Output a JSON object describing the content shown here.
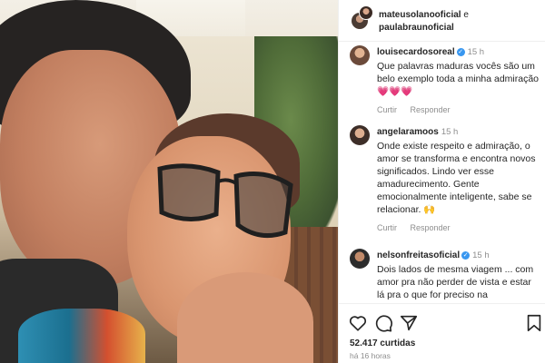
{
  "post": {
    "authors": [
      "mateusolanooficial",
      "paulabraunoficial"
    ],
    "conjunction": "e"
  },
  "comments": [
    {
      "user": "louisecardosoreal",
      "verified": true,
      "time": "15 h",
      "text": "Que palavras maduras vocês são um belo exemplo toda a minha admiração",
      "emoji": "💗💗💗",
      "reply_label": "Curtir",
      "respond_label": "Responder"
    },
    {
      "user": "angelaramoos",
      "verified": false,
      "time": "15 h",
      "text": "Onde existe respeito e admiração, o amor se transforma e encontra novos significados. Lindo ver esse amadurecimento. Gente emocionalmente inteligente, sabe se relacionar.",
      "emoji": "🙌",
      "reply_label": "Curtir",
      "respond_label": "Responder"
    },
    {
      "user": "nelsonfreitasoficial",
      "verified": true,
      "time": "15 h",
      "text": "Dois lados de mesma viagem ... com amor pra não perder de vista e estar lá pra o que for preciso na",
      "emoji": "",
      "reply_label": "",
      "respond_label": ""
    }
  ],
  "footer": {
    "likes": "52.417 curtidas",
    "time_ago": "há 16 horas",
    "icons": [
      "heart-icon",
      "comment-icon",
      "share-icon",
      "bookmark-icon"
    ]
  },
  "colors": {
    "verified": "#3897f0",
    "heart": "#ed4956",
    "muted": "#8e8e8e"
  }
}
